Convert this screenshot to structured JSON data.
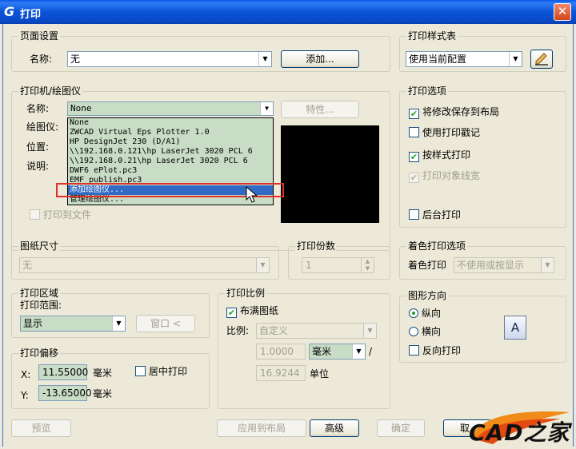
{
  "window": {
    "title": "打印",
    "close_glyph": "✕"
  },
  "page_setup": {
    "legend": "页面设置",
    "name_label": "名称:",
    "name_value": "无",
    "add_button": "添加..."
  },
  "plot_style": {
    "legend": "打印样式表",
    "value": "使用当前配置"
  },
  "printer": {
    "legend": "打印机/绘图仪",
    "name_label": "名称:",
    "name_value": "None",
    "properties_button": "特性...",
    "plotter_label": "绘图仪:",
    "location_label": "位置:",
    "description_label": "说明:",
    "print_to_file": "打印到文件",
    "options": [
      "None",
      "ZWCAD Virtual Eps Plotter 1.0",
      "HP DesignJet 230 (D/A1)",
      "\\\\192.168.0.121\\hp LaserJet 3020 PCL 6",
      "\\\\192.168.0.21\\hp LaserJet 3020 PCL 6",
      "DWF6 ePlot.pc3",
      "EMF publish.pc3",
      "添加绘图仪...",
      "管理绘图仪..."
    ],
    "selected_index": 7
  },
  "plot_options": {
    "legend": "打印选项",
    "items": [
      {
        "label": "将修改保存到布局",
        "checked": true,
        "enabled": true
      },
      {
        "label": "使用打印戳记",
        "checked": false,
        "enabled": true
      },
      {
        "label": "按样式打印",
        "checked": true,
        "enabled": true
      },
      {
        "label": "打印对象线宽",
        "checked": true,
        "enabled": false
      },
      {
        "label": "后台打印",
        "checked": false,
        "enabled": true
      }
    ]
  },
  "paper_size": {
    "legend": "图纸尺寸",
    "value": "无"
  },
  "copies": {
    "legend": "打印份数",
    "value": "1"
  },
  "shade_options": {
    "legend": "着色打印选项",
    "label": "着色打印",
    "value": "不使用或按显示"
  },
  "plot_area": {
    "legend": "打印区域",
    "range_label": "打印范围:",
    "range_value": "显示",
    "window_button": "窗口 <"
  },
  "plot_scale": {
    "legend": "打印比例",
    "fit_label": "布满图纸",
    "fit_checked": true,
    "scale_label": "比例:",
    "scale_value": "自定义",
    "numerator": "1.0000",
    "unit": "毫米",
    "slash": "/",
    "denominator": "16.9244",
    "units_label": "单位"
  },
  "orientation": {
    "legend": "图形方向",
    "portrait": "纵向",
    "landscape": "横向",
    "reverse": "反向打印",
    "selected": "portrait",
    "icon_letter": "A"
  },
  "plot_offset": {
    "legend": "打印偏移",
    "x_label": "X:",
    "x_value": "11.55000",
    "y_label": "Y:",
    "y_value": "-13.65000",
    "unit": "毫米",
    "center_label": "居中打印"
  },
  "footer": {
    "preview": "预览",
    "apply_layout": "应用到布局",
    "advanced": "高级",
    "ok": "确定",
    "cancel": "取"
  },
  "watermark": {
    "text": "CAD之家"
  }
}
